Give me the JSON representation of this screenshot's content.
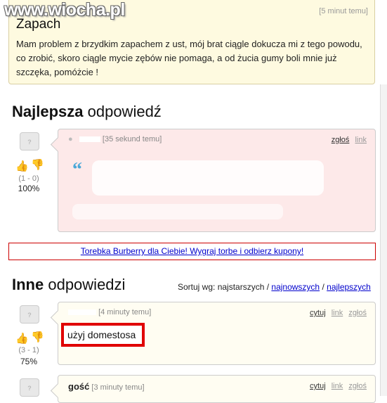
{
  "watermark": "www.wiocha.pl",
  "question": {
    "time": "[5 minut temu]",
    "title": "Zapach",
    "body": "Mam problem z brzydkim zapachem z ust, mój brat ciągle dokucza mi z tego powodu, co zrobić, skoro ciągle mycie zębów nie pomaga, a od żucia gumy boli mnie już szczęka, pomóżcie !"
  },
  "best": {
    "heading_bold": "Najlepsza",
    "heading_rest": " odpowiedź",
    "avatar_text": "?",
    "time": "[35 sekund temu]",
    "link_report": "zgłoś",
    "link_link": "link",
    "vote_counts": "(1 - 0)",
    "percent": "100%"
  },
  "ad": {
    "text": "Torebka Burberry dla Ciebie! Wygraj torbe i odbierz kupony!"
  },
  "others": {
    "heading_bold": "Inne",
    "heading_rest": " odpowiedzi",
    "sort_label": "Sortuj wg: najstarszych /",
    "sort_newest": "najnowszych",
    "sort_sep": "/",
    "sort_best": "najlepszych",
    "answers": [
      {
        "author": "",
        "time": "[4 minuty temu]",
        "text": "użyj domestosa",
        "vote_counts": "(3 - 1)",
        "percent": "75%",
        "link_quote": "cytuj",
        "link_link": "link",
        "link_report": "zgłoś"
      },
      {
        "author": "gość",
        "time": "[3 minuty temu]",
        "link_quote": "cytuj",
        "link_link": "link",
        "link_report": "zgłoś"
      }
    ]
  },
  "colors": {
    "best_bg": "#fde9e9",
    "answer_bg": "#fffdf2",
    "highlight": "#e00000"
  }
}
